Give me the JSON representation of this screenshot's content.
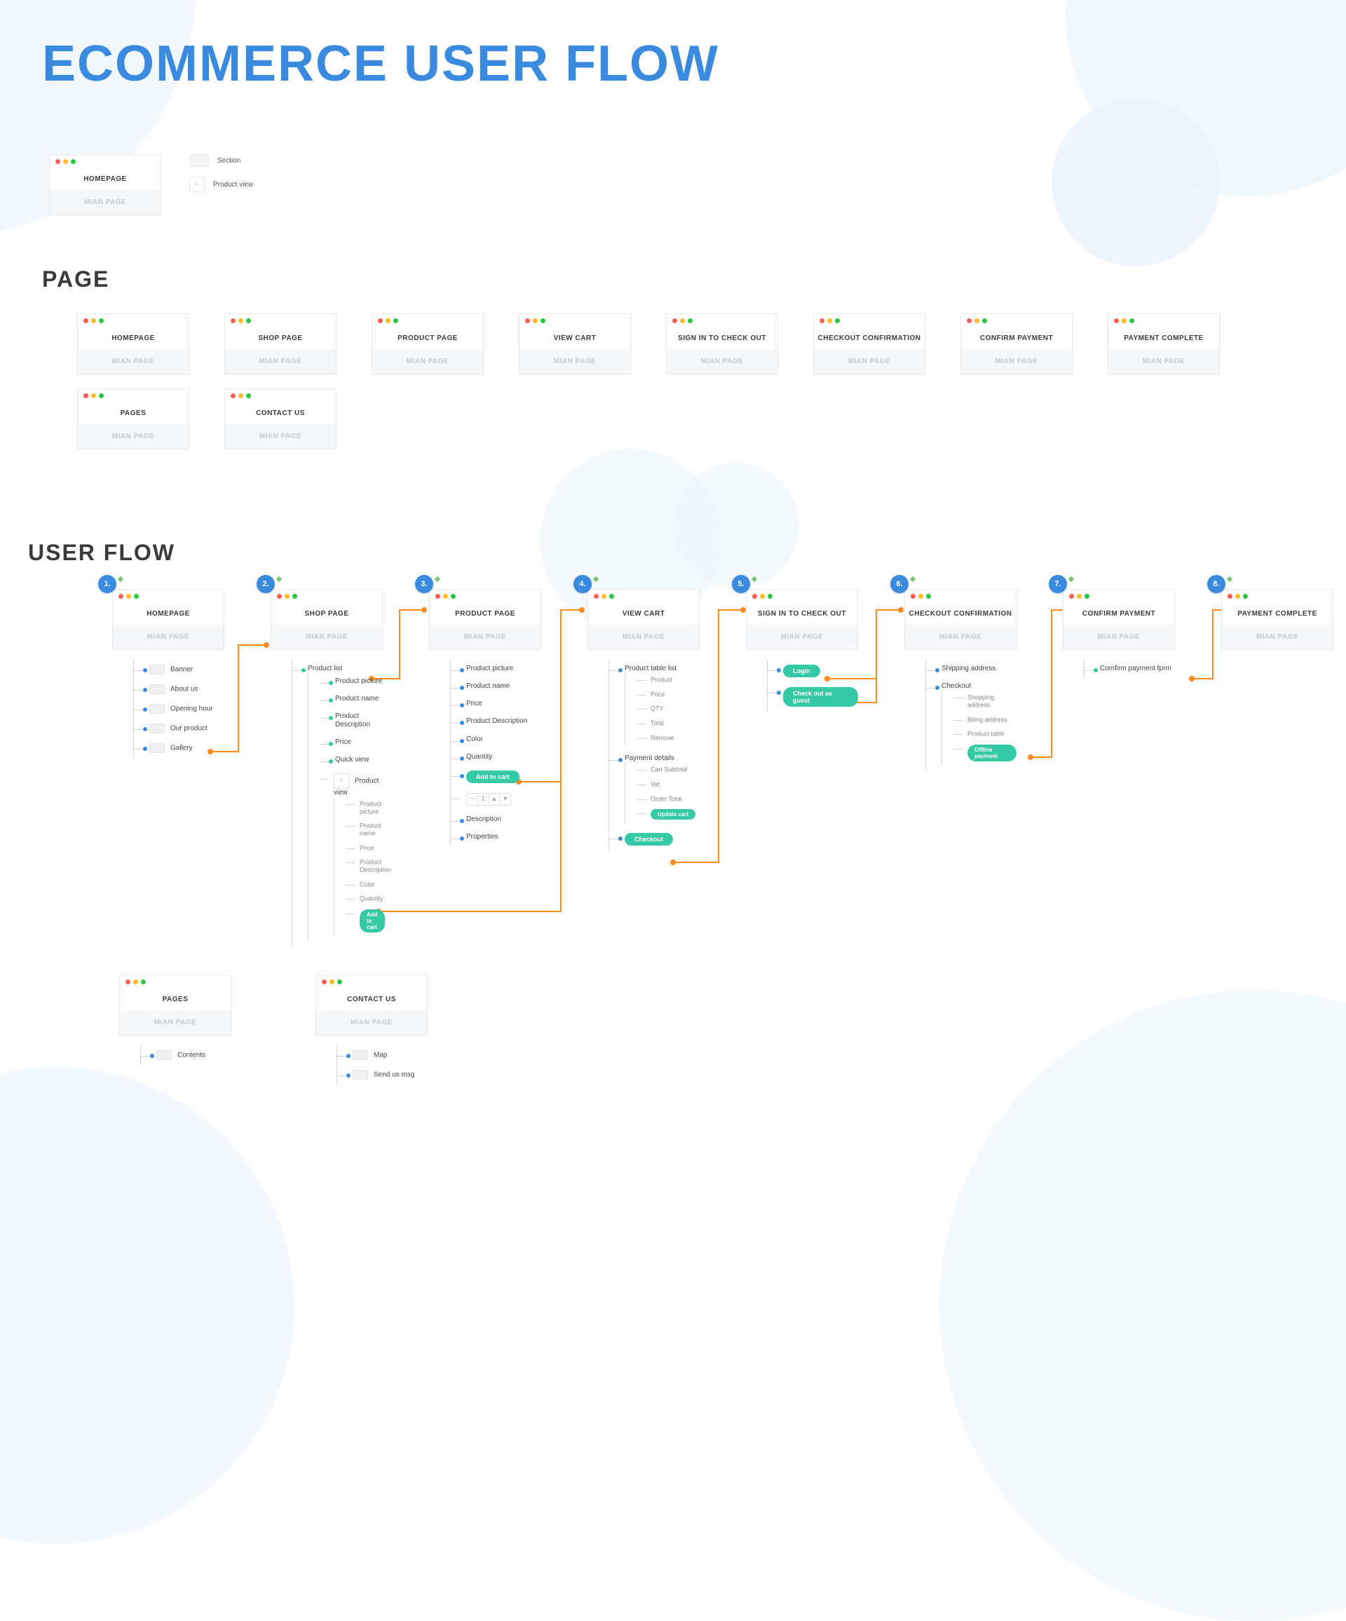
{
  "title": "ECOMMERCE USER FLOW",
  "legend": {
    "card_title": "HOMEPAGE",
    "card_sub": "MIAN PAGE",
    "section_label": "Section",
    "product_view_label": "Product view"
  },
  "page_heading": "PAGE",
  "page_sub": "MIAN PAGE",
  "pages_row1": [
    "HOMEPAGE",
    "SHOP PAGE",
    "PRODUCT PAGE",
    "VIEW CART",
    "SIGN IN TO CHECK OUT",
    "CHECKOUT CONFIRMATION",
    "CONFIRM PAYMENT",
    "PAYMENT COMPLETE"
  ],
  "pages_row2": [
    "PAGES",
    "CONTACT US"
  ],
  "flow_heading": "USER FLOW",
  "flow": [
    {
      "num": "1.",
      "title": "HOMEPAGE",
      "sub": "MIAN PAGE",
      "items": [
        "Banner",
        "About us",
        "Opening hour",
        "Our product",
        "Gallery"
      ]
    },
    {
      "num": "2.",
      "title": "SHOP PAGE",
      "sub": "MIAN PAGE",
      "product_list_label": "Product list",
      "list_items": [
        "Product picture",
        "Product name",
        "Product Description",
        "Price",
        "Quick view"
      ],
      "pv_label": "Product view",
      "pv_items": [
        "Product picture",
        "Product name",
        "Price",
        "Product Description",
        "Color",
        "Quantity"
      ],
      "pv_action": "Add to cart"
    },
    {
      "num": "3.",
      "title": "PRODUCT PAGE",
      "sub": "MIAN PAGE",
      "items": [
        "Product picture",
        "Product name",
        "Price",
        "Product Description",
        "Color",
        "Quantity"
      ],
      "action": "Add to cart",
      "qty_value": "1",
      "after": [
        "Description",
        "Properties"
      ]
    },
    {
      "num": "4.",
      "title": "VIEW CART",
      "sub": "MIAN PAGE",
      "table_label": "Product table list",
      "table_items": [
        "Product",
        "Price",
        "QTY",
        "Total",
        "Remove"
      ],
      "pay_label": "Payment details",
      "pay_items": [
        "Cart Subtotal",
        "Vat",
        "Order Total"
      ],
      "action_update": "Update cart",
      "action_checkout": "Checkout"
    },
    {
      "num": "5.",
      "title": "SIGN IN TO CHECK OUT",
      "sub": "MIAN PAGE",
      "action_login": "Login",
      "action_guest": "Check out as guest"
    },
    {
      "num": "6.",
      "title": "CHECKOUT CONFIRMATION",
      "sub": "MIAN PAGE",
      "items": [
        "Shipping address",
        "Checkout"
      ],
      "sub_items": [
        "Shopping address",
        "Biling address",
        "Product table"
      ],
      "action": "Offline payment"
    },
    {
      "num": "7.",
      "title": "CONFIRM PAYMENT",
      "sub": "MIAN PAGE",
      "item": "Comfirm payment fprm"
    },
    {
      "num": "8.",
      "title": "PAYMENT COMPLETE",
      "sub": "MIAN PAGE"
    }
  ],
  "flow_bottom": [
    {
      "title": "PAGES",
      "sub": "MIAN PAGE",
      "items": [
        "Contents"
      ]
    },
    {
      "title": "CONTACT US",
      "sub": "MIAN PAGE",
      "items": [
        "Map",
        "Send us msg"
      ]
    }
  ]
}
